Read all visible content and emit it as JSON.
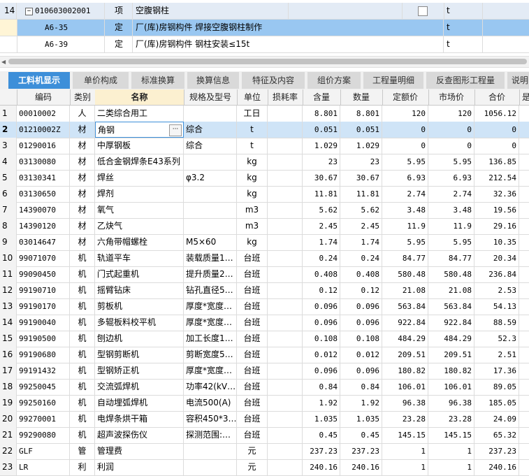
{
  "top_rows": [
    {
      "num": "14",
      "code": "010603002001",
      "type": "项",
      "name": "空腹钢柱",
      "unit": "t",
      "expand": "−",
      "has_checkbox": true
    },
    {
      "num": "",
      "code": "A6-35",
      "type": "定",
      "name": "厂(库)房钢构件 焊接空腹钢柱制作",
      "unit": "t"
    },
    {
      "num": "",
      "code": "A6-39",
      "type": "定",
      "name": "厂(库)房钢构件 钢柱安装≤15t",
      "unit": "t"
    }
  ],
  "tabs": [
    "工料机显示",
    "单价构成",
    "标准换算",
    "换算信息",
    "特征及内容",
    "组价方案",
    "工程量明细",
    "反查图形工程量",
    "说明"
  ],
  "active_tab": 0,
  "columns": [
    "编码",
    "类别",
    "名称",
    "规格及型号",
    "单位",
    "损耗率",
    "含量",
    "数量",
    "定额价",
    "市场价",
    "合价",
    "是"
  ],
  "rows": [
    {
      "n": "1",
      "code": "00010002",
      "cat": "人",
      "name": "二类综合用工",
      "spec": "",
      "unit": "工日",
      "loss": "",
      "qty": "8.801",
      "amt": "8.801",
      "price": "120",
      "market": "120",
      "total": "1056.12"
    },
    {
      "n": "2",
      "code": "01210002Z",
      "cat": "材",
      "name": "角钢",
      "spec": "综合",
      "unit": "t",
      "loss": "",
      "qty": "0.051",
      "amt": "0.051",
      "price": "0",
      "market": "0",
      "total": "0"
    },
    {
      "n": "3",
      "code": "01290016",
      "cat": "材",
      "name": "中厚钢板",
      "spec": "综合",
      "unit": "t",
      "loss": "",
      "qty": "1.029",
      "amt": "1.029",
      "price": "0",
      "market": "0",
      "total": "0"
    },
    {
      "n": "4",
      "code": "03130080",
      "cat": "材",
      "name": "低合金钢焊条E43系列",
      "spec": "",
      "unit": "kg",
      "loss": "",
      "qty": "23",
      "amt": "23",
      "price": "5.95",
      "market": "5.95",
      "total": "136.85"
    },
    {
      "n": "5",
      "code": "03130341",
      "cat": "材",
      "name": "焊丝",
      "spec": "φ3.2",
      "unit": "kg",
      "loss": "",
      "qty": "30.67",
      "amt": "30.67",
      "price": "6.93",
      "market": "6.93",
      "total": "212.54"
    },
    {
      "n": "6",
      "code": "03130650",
      "cat": "材",
      "name": "焊剂",
      "spec": "",
      "unit": "kg",
      "loss": "",
      "qty": "11.81",
      "amt": "11.81",
      "price": "2.74",
      "market": "2.74",
      "total": "32.36"
    },
    {
      "n": "7",
      "code": "14390070",
      "cat": "材",
      "name": "氧气",
      "spec": "",
      "unit": "m3",
      "loss": "",
      "qty": "5.62",
      "amt": "5.62",
      "price": "3.48",
      "market": "3.48",
      "total": "19.56"
    },
    {
      "n": "8",
      "code": "14390120",
      "cat": "材",
      "name": "乙炔气",
      "spec": "",
      "unit": "m3",
      "loss": "",
      "qty": "2.45",
      "amt": "2.45",
      "price": "11.9",
      "market": "11.9",
      "total": "29.16"
    },
    {
      "n": "9",
      "code": "03014647",
      "cat": "材",
      "name": "六角带帽螺栓",
      "spec": "M5×60",
      "unit": "kg",
      "loss": "",
      "qty": "1.74",
      "amt": "1.74",
      "price": "5.95",
      "market": "5.95",
      "total": "10.35"
    },
    {
      "n": "10",
      "code": "99071070",
      "cat": "机",
      "name": "轨道平车",
      "spec": "装载质量1…",
      "unit": "台班",
      "loss": "",
      "qty": "0.24",
      "amt": "0.24",
      "price": "84.77",
      "market": "84.77",
      "total": "20.34"
    },
    {
      "n": "11",
      "code": "99090450",
      "cat": "机",
      "name": "门式起重机",
      "spec": "提升质量2…",
      "unit": "台班",
      "loss": "",
      "qty": "0.408",
      "amt": "0.408",
      "price": "580.48",
      "market": "580.48",
      "total": "236.84"
    },
    {
      "n": "12",
      "code": "99190710",
      "cat": "机",
      "name": "摇臂钻床",
      "spec": "钻孔直径5…",
      "unit": "台班",
      "loss": "",
      "qty": "0.12",
      "amt": "0.12",
      "price": "21.08",
      "market": "21.08",
      "total": "2.53"
    },
    {
      "n": "13",
      "code": "99190170",
      "cat": "机",
      "name": "剪板机",
      "spec": "厚度*宽度…",
      "unit": "台班",
      "loss": "",
      "qty": "0.096",
      "amt": "0.096",
      "price": "563.84",
      "market": "563.84",
      "total": "54.13"
    },
    {
      "n": "14",
      "code": "99190040",
      "cat": "机",
      "name": "多辊板料校平机",
      "spec": "厚度*宽度…",
      "unit": "台班",
      "loss": "",
      "qty": "0.096",
      "amt": "0.096",
      "price": "922.84",
      "market": "922.84",
      "total": "88.59"
    },
    {
      "n": "15",
      "code": "99190500",
      "cat": "机",
      "name": "刨边机",
      "spec": "加工长度1…",
      "unit": "台班",
      "loss": "",
      "qty": "0.108",
      "amt": "0.108",
      "price": "484.29",
      "market": "484.29",
      "total": "52.3"
    },
    {
      "n": "16",
      "code": "99190680",
      "cat": "机",
      "name": "型钢剪断机",
      "spec": "剪断宽度5…",
      "unit": "台班",
      "loss": "",
      "qty": "0.012",
      "amt": "0.012",
      "price": "209.51",
      "market": "209.51",
      "total": "2.51"
    },
    {
      "n": "17",
      "code": "99191432",
      "cat": "机",
      "name": "型钢矫正机",
      "spec": "厚度*宽度…",
      "unit": "台班",
      "loss": "",
      "qty": "0.096",
      "amt": "0.096",
      "price": "180.82",
      "market": "180.82",
      "total": "17.36"
    },
    {
      "n": "18",
      "code": "99250045",
      "cat": "机",
      "name": "交流弧焊机",
      "spec": "功率42(kV…",
      "unit": "台班",
      "loss": "",
      "qty": "0.84",
      "amt": "0.84",
      "price": "106.01",
      "market": "106.01",
      "total": "89.05"
    },
    {
      "n": "19",
      "code": "99250160",
      "cat": "机",
      "name": "自动埋弧焊机",
      "spec": "电流500(A)",
      "unit": "台班",
      "loss": "",
      "qty": "1.92",
      "amt": "1.92",
      "price": "96.38",
      "market": "96.38",
      "total": "185.05"
    },
    {
      "n": "20",
      "code": "99270001",
      "cat": "机",
      "name": "电焊条烘干箱",
      "spec": "容积450*3…",
      "unit": "台班",
      "loss": "",
      "qty": "1.035",
      "amt": "1.035",
      "price": "23.28",
      "market": "23.28",
      "total": "24.09"
    },
    {
      "n": "21",
      "code": "99290080",
      "cat": "机",
      "name": "超声波探伤仪",
      "spec": "探测范围:…",
      "unit": "台班",
      "loss": "",
      "qty": "0.45",
      "amt": "0.45",
      "price": "145.15",
      "market": "145.15",
      "total": "65.32"
    },
    {
      "n": "22",
      "code": "GLF",
      "cat": "管",
      "name": "管理费",
      "spec": "",
      "unit": "元",
      "loss": "",
      "qty": "237.23",
      "amt": "237.23",
      "price": "1",
      "market": "1",
      "total": "237.23"
    },
    {
      "n": "23",
      "code": "LR",
      "cat": "利",
      "name": "利润",
      "spec": "",
      "unit": "元",
      "loss": "",
      "qty": "240.16",
      "amt": "240.16",
      "price": "1",
      "market": "1",
      "total": "240.16"
    }
  ],
  "selected_row": 1,
  "colors": {
    "accent": "#3d8fd9",
    "selected": "#99c7f1",
    "row_selected": "#cfe4f7",
    "name_header": "#fcf0d0"
  }
}
